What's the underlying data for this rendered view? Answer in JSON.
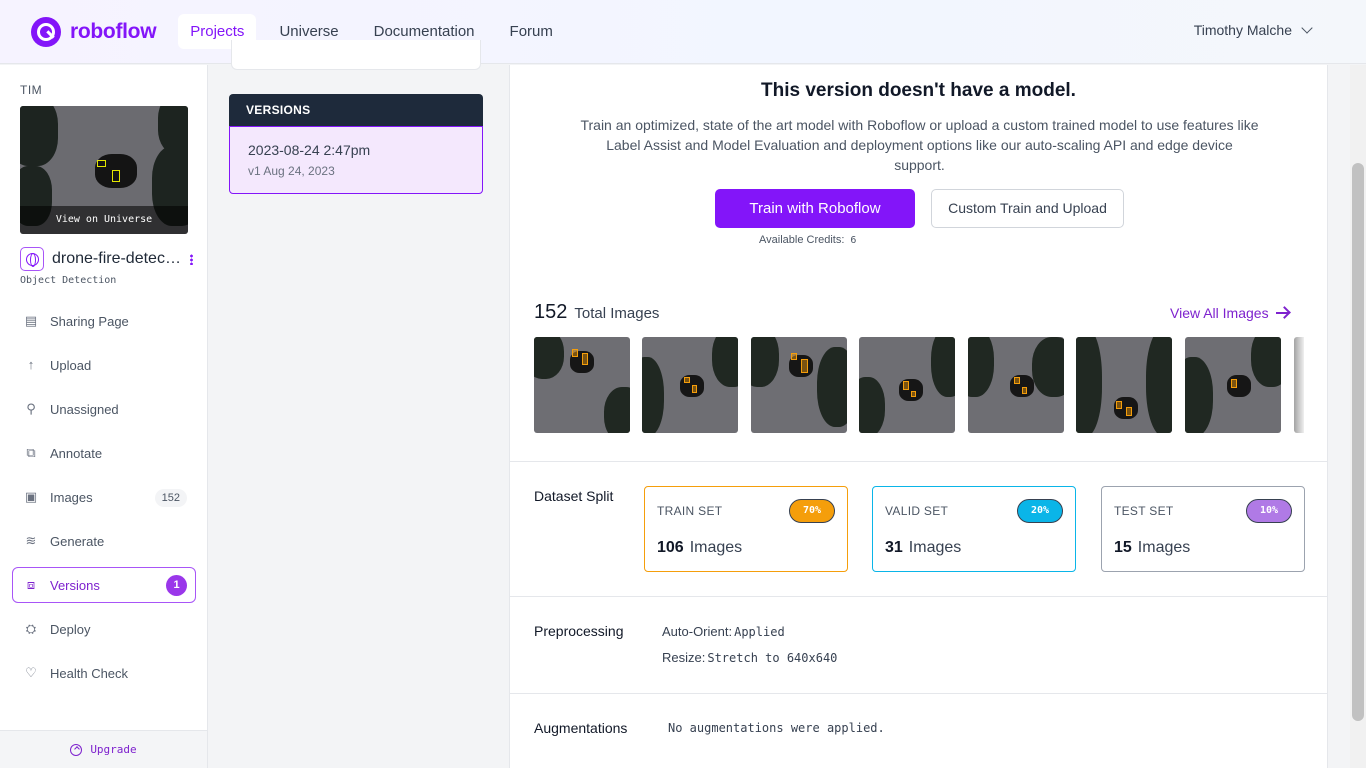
{
  "nav": {
    "brand": "roboflow",
    "links": [
      "Projects",
      "Universe",
      "Documentation",
      "Forum"
    ],
    "active": "Projects",
    "user": "Timothy Malche"
  },
  "sidebar": {
    "workspace": "TIM",
    "thumb_caption": "View on Universe",
    "project_name": "drone-fire-detection",
    "project_type": "Object Detection",
    "items": [
      {
        "label": "Sharing Page",
        "icon": "page-icon"
      },
      {
        "label": "Upload",
        "icon": "upload-arrow-icon"
      },
      {
        "label": "Unassigned",
        "icon": "search-icon"
      },
      {
        "label": "Annotate",
        "icon": "annotate-icon"
      },
      {
        "label": "Images",
        "icon": "images-icon",
        "count": "152"
      },
      {
        "label": "Generate",
        "icon": "generate-icon"
      },
      {
        "label": "Versions",
        "icon": "versions-icon",
        "badge": "1",
        "active": true
      },
      {
        "label": "Deploy",
        "icon": "deploy-icon"
      },
      {
        "label": "Health Check",
        "icon": "health-icon"
      }
    ],
    "upgrade": "Upgrade"
  },
  "versions": {
    "header": "VERSIONS",
    "selected_title": "2023-08-24 2:47pm",
    "selected_sub": "v1 Aug 24, 2023"
  },
  "model": {
    "title": "This version doesn't have a model.",
    "description": "Train an optimized, state of the art model with Roboflow or upload a custom trained model to use features like Label Assist and Model Evaluation and deployment options like our auto-scaling API and edge device support.",
    "train_button": "Train with Roboflow",
    "custom_button": "Custom Train and Upload",
    "credits_label": "Available Credits:",
    "credits_value": "6"
  },
  "images": {
    "total": "152",
    "total_label": "Total Images",
    "view_all": "View All Images"
  },
  "split": {
    "label": "Dataset Split",
    "unit": "Images",
    "sets": [
      {
        "name": "TRAIN SET",
        "pct": "70%",
        "count": "106",
        "color": "#f59e0b"
      },
      {
        "name": "VALID SET",
        "pct": "20%",
        "count": "31",
        "color": "#0ab5e8"
      },
      {
        "name": "TEST SET",
        "pct": "10%",
        "count": "15",
        "color": "#b07ae6"
      }
    ]
  },
  "preprocessing": {
    "label": "Preprocessing",
    "auto_orient_key": "Auto-Orient:",
    "auto_orient_val": "Applied",
    "resize_key": "Resize:",
    "resize_val": "Stretch to 640x640"
  },
  "augmentations": {
    "label": "Augmentations",
    "value": "No augmentations were applied."
  },
  "colors": {
    "brand": "#8315f9",
    "nav_dark": "#1e2a3b"
  }
}
